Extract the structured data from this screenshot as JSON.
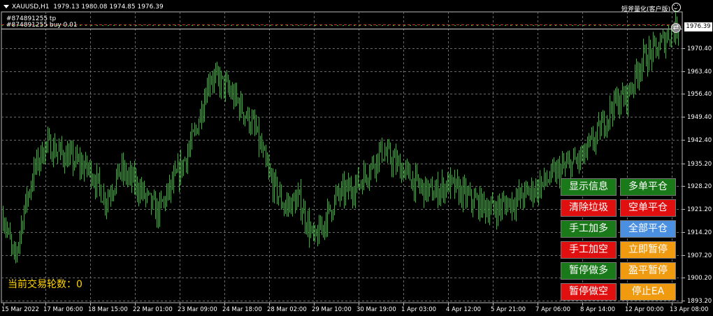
{
  "header": {
    "symbol": "XAUUSD,H1",
    "ohlc": "1979.13 1980.08 1974.85 1976.39",
    "order_tp": "#874891255 tp",
    "order_buy": "#874891255 buy 0.01",
    "brand": "短斧量化(客户版)"
  },
  "current_price": "1976.39",
  "price_axis": [
    "1970.40",
    "1963.40",
    "1956.40",
    "1949.40",
    "1942.40",
    "1935.20",
    "1928.20",
    "1921.20",
    "1914.20",
    "1907.20",
    "1900.20",
    "1893.20"
  ],
  "time_axis": [
    "15 Mar 2022",
    "17 Mar 06:00",
    "18 Mar 15:00",
    "22 Mar 01:00",
    "23 Mar 09:00",
    "24 Mar 18:00",
    "28 Mar 02:00",
    "29 Mar 10:00",
    "30 Mar 19:00",
    "1 Apr 03:00",
    "4 Apr 12:00",
    "5 Apr 21:00",
    "7 Apr 06:00",
    "8 Apr 14:00",
    "12 Apr 00:00",
    "13 Apr 08:00"
  ],
  "counter": {
    "label": "当前交易轮数：",
    "value": "0"
  },
  "buttons": {
    "show_info": "显示信息",
    "close_long": "多单平仓",
    "clear_trash": "清除垃圾",
    "close_short": "空单平仓",
    "manual_add_long": "手工加多",
    "close_all": "全部平仓",
    "manual_add_short": "手工加空",
    "pause_now": "立即暂停",
    "pause_long": "暂停做多",
    "profit_pause": "盈平暂停",
    "pause_short": "暂停做空",
    "stop_ea": "停止EA"
  },
  "colors": {
    "background": "#000000",
    "grid": "#6b6b6b",
    "candle": "#2eb82e",
    "button_green": "#1a7a1a",
    "button_red": "#e01010",
    "button_blue": "#4a8fe0",
    "button_orange": "#f09a10",
    "counter_text": "#ffd400"
  },
  "chart_data": {
    "type": "ohlc",
    "symbol": "XAUUSD",
    "timeframe": "H1",
    "ylim": [
      1893.2,
      1976.39
    ],
    "x_range": [
      "15 Mar 2022",
      "13 Apr 08:00"
    ],
    "grid": true,
    "close_path": [
      [
        "15 Mar 2022",
        1919
      ],
      [
        "15 Mar 12:00",
        1905
      ],
      [
        "16 Mar 02:00",
        1922
      ],
      [
        "16 Mar 14:00",
        1934
      ],
      [
        "17 Mar 06:00",
        1941
      ],
      [
        "17 Mar 18:00",
        1937
      ],
      [
        "18 Mar 15:00",
        1933
      ],
      [
        "19 Mar 12:00",
        1924
      ],
      [
        "21 Mar 08:00",
        1933
      ],
      [
        "22 Mar 01:00",
        1929
      ],
      [
        "22 Mar 14:00",
        1920
      ],
      [
        "23 Mar 09:00",
        1933
      ],
      [
        "23 Mar 20:00",
        1944
      ],
      [
        "24 Mar 08:00",
        1962
      ],
      [
        "24 Mar 18:00",
        1959
      ],
      [
        "25 Mar 12:00",
        1953
      ],
      [
        "27 Mar 20:00",
        1946
      ],
      [
        "28 Mar 02:00",
        1931
      ],
      [
        "28 Mar 14:00",
        1922
      ],
      [
        "29 Mar 00:00",
        1924
      ],
      [
        "29 Mar 10:00",
        1911
      ],
      [
        "30 Mar 00:00",
        1925
      ],
      [
        "30 Mar 19:00",
        1929
      ],
      [
        "31 Mar 10:00",
        1939
      ],
      [
        "1 Apr 03:00",
        1933
      ],
      [
        "2 Apr 10:00",
        1928
      ],
      [
        "3 Apr 20:00",
        1926
      ],
      [
        "4 Apr 12:00",
        1929
      ],
      [
        "5 Apr 04:00",
        1924
      ],
      [
        "5 Apr 21:00",
        1921
      ],
      [
        "6 Apr 14:00",
        1924
      ],
      [
        "7 Apr 06:00",
        1928
      ],
      [
        "8 Apr 00:00",
        1933
      ],
      [
        "8 Apr 14:00",
        1937
      ],
      [
        "10 Apr 08:00",
        1944
      ],
      [
        "11 Apr 12:00",
        1953
      ],
      [
        "12 Apr 00:00",
        1956
      ],
      [
        "12 Apr 12:00",
        1967
      ],
      [
        "13 Apr 00:00",
        1970
      ],
      [
        "13 Apr 08:00",
        1976.39
      ]
    ]
  }
}
